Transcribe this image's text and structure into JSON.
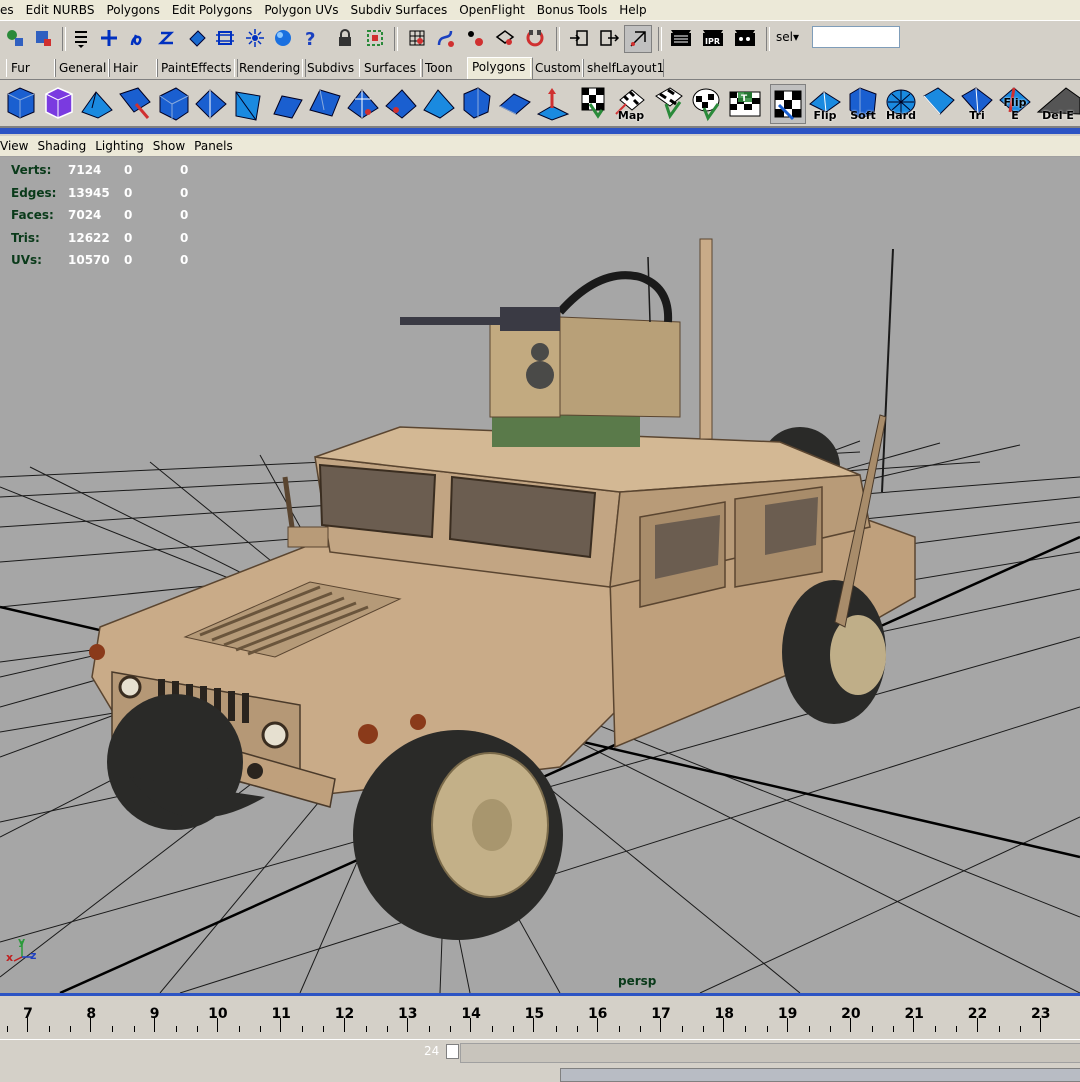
{
  "menubar": {
    "items": [
      "es",
      "Edit NURBS",
      "Polygons",
      "Edit Polygons",
      "Polygon UVs",
      "Subdiv Surfaces",
      "OpenFlight",
      "Bonus Tools",
      "Help"
    ]
  },
  "toolbar": {
    "sel_label": "sel",
    "sel_value": ""
  },
  "shelf_tabs": [
    "Fur",
    "General",
    "Hair",
    "PaintEffects",
    "Rendering",
    "Subdivs",
    "Surfaces",
    "Toon",
    "Polygons",
    "Custom",
    "shelfLayout1"
  ],
  "active_shelf_tab": "Polygons",
  "shelf_labels": {
    "map": "Map",
    "flip": "Flip",
    "soft": "Soft",
    "hard": "Hard",
    "tri": "Tri",
    "flip_e": "Flip E",
    "del_e": "Del E"
  },
  "panel_menu": [
    "View",
    "Shading",
    "Lighting",
    "Show",
    "Panels"
  ],
  "hud": [
    {
      "label": "Verts:",
      "v1": "7124",
      "v2": "0",
      "v3": "0"
    },
    {
      "label": "Edges:",
      "v1": "13945",
      "v2": "0",
      "v3": "0"
    },
    {
      "label": "Faces:",
      "v1": "7024",
      "v2": "0",
      "v3": "0"
    },
    {
      "label": "Tris:",
      "v1": "12622",
      "v2": "0",
      "v3": "0"
    },
    {
      "label": "UVs:",
      "v1": "10570",
      "v2": "0",
      "v3": "0"
    }
  ],
  "camera_name": "persp",
  "axis": {
    "x": "x",
    "y": "y",
    "z": "z"
  },
  "timeline": {
    "frames": [
      "7",
      "8",
      "9",
      "10",
      "11",
      "12",
      "13",
      "14",
      "15",
      "16",
      "17",
      "18",
      "19",
      "20",
      "21",
      "22",
      "23"
    ],
    "range_end": "24"
  },
  "colors": {
    "accent": "#2c54c4",
    "viewport_bg": "#a6a6a6",
    "hud_label": "#0a3a1a",
    "vehicle": "#c9ab88"
  }
}
